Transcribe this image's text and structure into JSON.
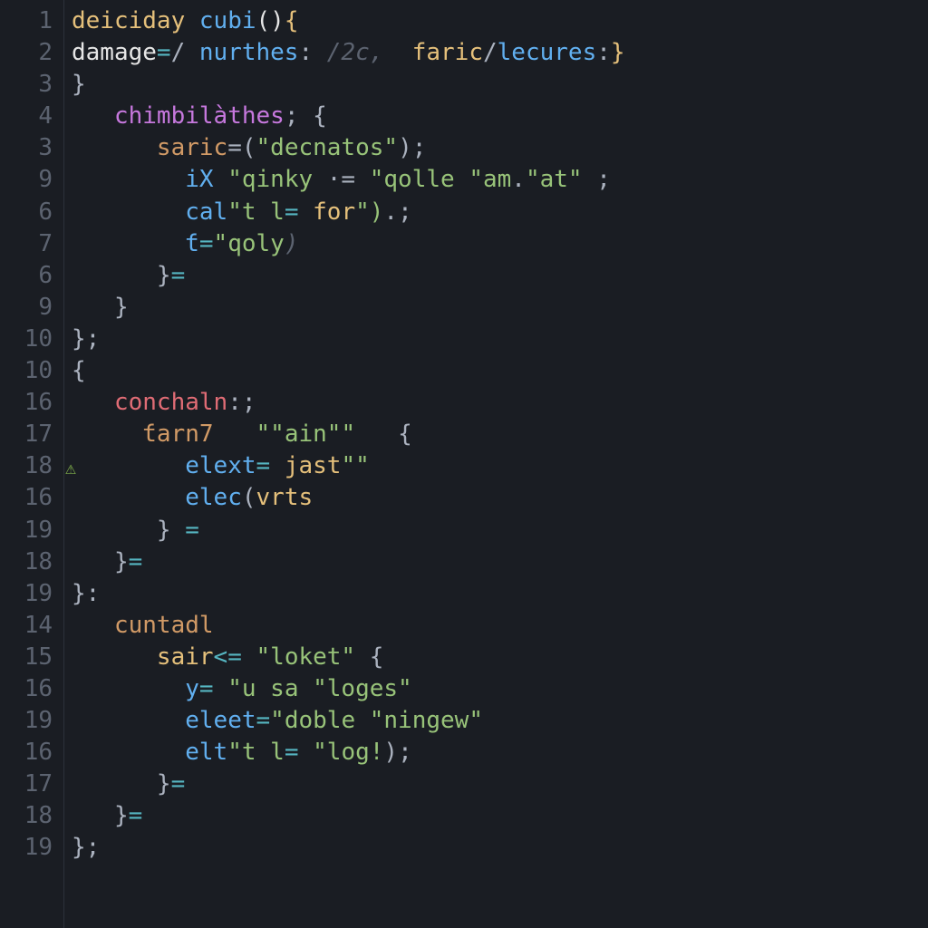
{
  "gutter": [
    "1",
    "2",
    "3",
    "4",
    "3",
    "9",
    "6",
    "7",
    "6",
    "9",
    "10",
    "10",
    "16",
    "17",
    "18",
    "16",
    "19",
    "18",
    "19",
    "14",
    "15",
    "16",
    "19",
    "16",
    "17",
    "18",
    "19"
  ],
  "warning_line_index": 14,
  "lines": [
    [
      {
        "t": "deiciday ",
        "c": "id"
      },
      {
        "t": "cubi",
        "c": "fn"
      },
      {
        "t": "()",
        "c": "white"
      },
      {
        "t": "{",
        "c": "id"
      }
    ],
    [
      {
        "t": "damage",
        "c": "white"
      },
      {
        "t": "=",
        "c": "op"
      },
      {
        "t": "/ ",
        "c": "pn"
      },
      {
        "t": "nurthes",
        "c": "fn"
      },
      {
        "t": ": ",
        "c": "pn"
      },
      {
        "t": "/2c,",
        "c": "cm"
      },
      {
        "t": "  ",
        "c": "pn"
      },
      {
        "t": "faric",
        "c": "id"
      },
      {
        "t": "/",
        "c": "pn"
      },
      {
        "t": "lecures",
        "c": "fn"
      },
      {
        "t": ":",
        "c": "pn"
      },
      {
        "t": "}",
        "c": "id"
      }
    ],
    [
      {
        "t": "}",
        "c": "pn"
      }
    ],
    [
      {
        "t": "   ",
        "c": "pn"
      },
      {
        "t": "chimbilàthes",
        "c": "kw"
      },
      {
        "t": "; {",
        "c": "pn"
      }
    ],
    [
      {
        "t": "      ",
        "c": "pn"
      },
      {
        "t": "saric",
        "c": "orange"
      },
      {
        "t": "=(",
        "c": "pn"
      },
      {
        "t": "\"decnatos\"",
        "c": "str"
      },
      {
        "t": ");",
        "c": "pn"
      }
    ],
    [
      {
        "t": "        ",
        "c": "pn"
      },
      {
        "t": "iX ",
        "c": "fn"
      },
      {
        "t": "\"qinky ",
        "c": "str"
      },
      {
        "t": "·= ",
        "c": "pn"
      },
      {
        "t": "\"qolle ",
        "c": "str"
      },
      {
        "t": "\"am",
        "c": "str"
      },
      {
        "t": ".",
        "c": "pn"
      },
      {
        "t": "\"at\"",
        "c": "str"
      },
      {
        "t": " ;",
        "c": "pn"
      }
    ],
    [
      {
        "t": "        ",
        "c": "pn"
      },
      {
        "t": "cal",
        "c": "fn"
      },
      {
        "t": "\"t l",
        "c": "str"
      },
      {
        "t": "= ",
        "c": "op"
      },
      {
        "t": "for",
        "c": "id"
      },
      {
        "t": "\")",
        "c": "str"
      },
      {
        "t": ".;",
        "c": "pn"
      }
    ],
    [
      {
        "t": "        ",
        "c": "pn"
      },
      {
        "t": "ƭ",
        "c": "fn"
      },
      {
        "t": "=",
        "c": "op"
      },
      {
        "t": "\"qoly",
        "c": "str"
      },
      {
        "t": ")",
        "c": "cm"
      }
    ],
    [
      {
        "t": "      }",
        "c": "pn"
      },
      {
        "t": "=",
        "c": "op"
      }
    ],
    [
      {
        "t": "   }",
        "c": "pn"
      }
    ],
    [
      {
        "t": "};",
        "c": "pn"
      }
    ],
    [
      {
        "t": "{",
        "c": "pn"
      }
    ],
    [
      {
        "t": "   ",
        "c": "pn"
      },
      {
        "t": "conchaln",
        "c": "prop"
      },
      {
        "t": ":;",
        "c": "pn"
      }
    ],
    [
      {
        "t": "     ",
        "c": "pn"
      },
      {
        "t": "ƭarn7",
        "c": "orange"
      },
      {
        "t": "   ",
        "c": "pn"
      },
      {
        "t": "\"\"ain\"\"",
        "c": "str"
      },
      {
        "t": "   {",
        "c": "pn"
      }
    ],
    [
      {
        "t": "        ",
        "c": "pn"
      },
      {
        "t": "elext",
        "c": "fn"
      },
      {
        "t": "= ",
        "c": "op"
      },
      {
        "t": "jast",
        "c": "id"
      },
      {
        "t": "\"\"",
        "c": "str"
      }
    ],
    [
      {
        "t": "        ",
        "c": "pn"
      },
      {
        "t": "elec",
        "c": "fn"
      },
      {
        "t": "(",
        "c": "pn"
      },
      {
        "t": "vrts",
        "c": "id"
      }
    ],
    [
      {
        "t": "      } ",
        "c": "pn"
      },
      {
        "t": "=",
        "c": "op"
      }
    ],
    [
      {
        "t": "   }",
        "c": "pn"
      },
      {
        "t": "=",
        "c": "op"
      }
    ],
    [
      {
        "t": "}:",
        "c": "pn"
      }
    ],
    [
      {
        "t": "   ",
        "c": "pn"
      },
      {
        "t": "cuntadl",
        "c": "orange"
      }
    ],
    [
      {
        "t": "      ",
        "c": "pn"
      },
      {
        "t": "sair",
        "c": "id"
      },
      {
        "t": "<= ",
        "c": "op"
      },
      {
        "t": "\"loket\"",
        "c": "str"
      },
      {
        "t": " {",
        "c": "pn"
      }
    ],
    [
      {
        "t": "        ",
        "c": "pn"
      },
      {
        "t": "y",
        "c": "fn"
      },
      {
        "t": "= ",
        "c": "op"
      },
      {
        "t": "\"u sa ",
        "c": "str"
      },
      {
        "t": "\"loges\"",
        "c": "str"
      }
    ],
    [
      {
        "t": "        ",
        "c": "pn"
      },
      {
        "t": "eleet",
        "c": "fn"
      },
      {
        "t": "=",
        "c": "op"
      },
      {
        "t": "\"doble ",
        "c": "str"
      },
      {
        "t": "\"ningew\"",
        "c": "str"
      }
    ],
    [
      {
        "t": "        ",
        "c": "pn"
      },
      {
        "t": "elt",
        "c": "fn"
      },
      {
        "t": "\"t l",
        "c": "str"
      },
      {
        "t": "= ",
        "c": "op"
      },
      {
        "t": "\"log!",
        "c": "str"
      },
      {
        "t": ");",
        "c": "pn"
      }
    ],
    [
      {
        "t": "      }",
        "c": "pn"
      },
      {
        "t": "=",
        "c": "op"
      }
    ],
    [
      {
        "t": "   }",
        "c": "pn"
      },
      {
        "t": "=",
        "c": "op"
      }
    ],
    [
      {
        "t": "};",
        "c": "pn"
      }
    ]
  ]
}
